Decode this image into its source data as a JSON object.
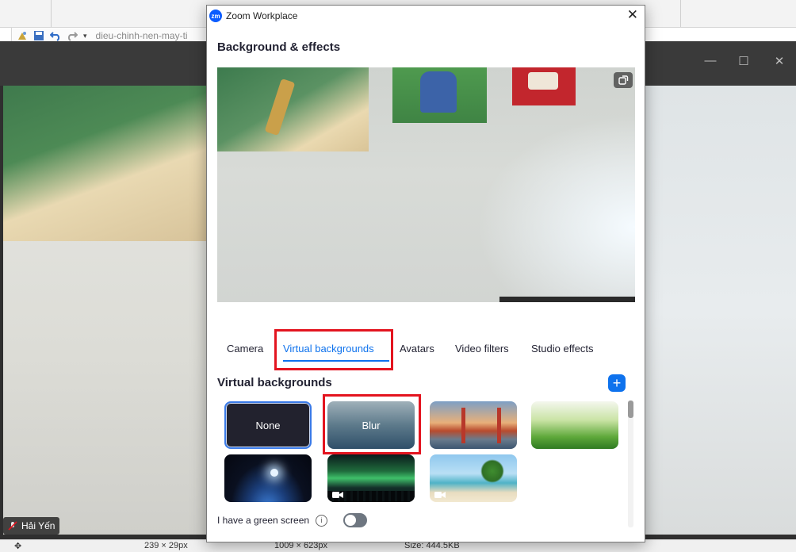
{
  "background_app": {
    "doc_title": "dieu-chinh-nen-may-ti",
    "participant_name": "Hải Yến",
    "status_bar": {
      "selection_size": "239 × 29px",
      "image_size": "1009 × 623px",
      "file_size": "Size: 444.5KB"
    }
  },
  "dialog": {
    "app_icon_text": "zm",
    "window_title": "Zoom Workplace",
    "close_label": "✕",
    "heading": "Background & effects",
    "tabs": [
      {
        "label": "Camera"
      },
      {
        "label": "Virtual backgrounds",
        "active": true
      },
      {
        "label": "Avatars"
      },
      {
        "label": "Video filters"
      },
      {
        "label": "Studio effects"
      }
    ],
    "virtual_backgrounds": {
      "heading": "Virtual backgrounds",
      "add_label": "+",
      "items": [
        {
          "label": "None",
          "selected": true
        },
        {
          "label": "Blur"
        },
        {
          "label": ""
        },
        {
          "label": ""
        },
        {
          "label": ""
        },
        {
          "label": "",
          "video": true
        },
        {
          "label": "",
          "video": true
        }
      ]
    },
    "green_screen": {
      "label": "I have a green screen",
      "info_glyph": "i",
      "enabled": false
    }
  },
  "colors": {
    "accent": "#0e72ed",
    "highlight": "#e3141f",
    "selected_border": "#3b7be8"
  }
}
